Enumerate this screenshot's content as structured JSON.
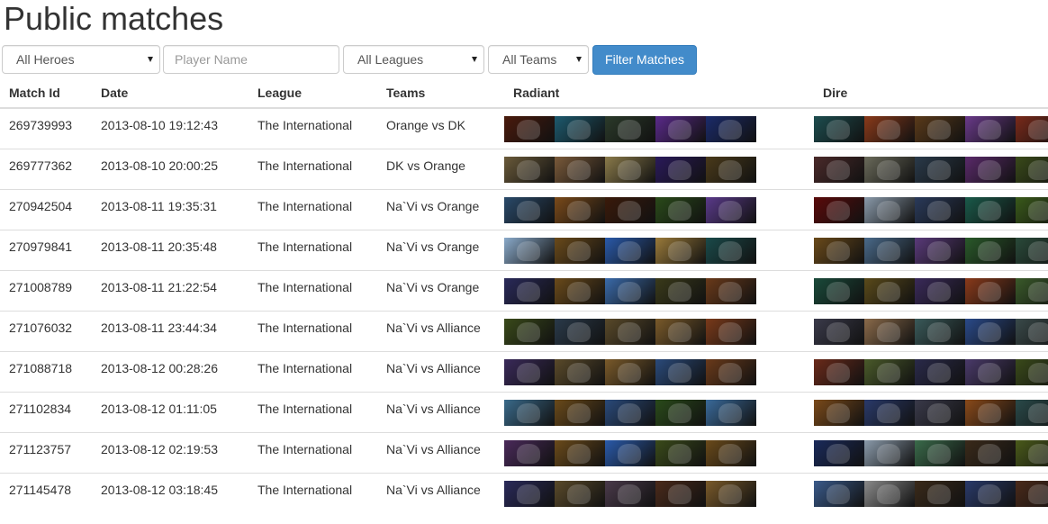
{
  "page": {
    "title": "Public matches"
  },
  "filters": {
    "heroes_selected": "All Heroes",
    "player_placeholder": "Player Name",
    "leagues_selected": "All Leagues",
    "teams_selected": "All Teams",
    "filter_button": "Filter Matches"
  },
  "table": {
    "headers": [
      "Match Id",
      "Date",
      "League",
      "Teams",
      "Radiant",
      "Dire"
    ],
    "rows": [
      {
        "match_id": "269739993",
        "date": "2013-08-10 19:12:43",
        "league": "The International",
        "teams": "Orange vs DK",
        "radiant": [
          "#4a1a0c",
          "#1d5a6e",
          "#2b3a2a",
          "#5a2a8a",
          "#1b2b6a"
        ],
        "dire": [
          "#1d4d4f",
          "#8a3a1a",
          "#5a3a1a",
          "#6a3a8a",
          "#7a2a1a"
        ]
      },
      {
        "match_id": "269777362",
        "date": "2013-08-10 20:00:25",
        "league": "The International",
        "teams": "DK vs Orange",
        "radiant": [
          "#6a5a3a",
          "#7a5a3a",
          "#8a7a4a",
          "#2a1a5a",
          "#4a3a1a"
        ],
        "dire": [
          "#4a2a2a",
          "#6a6a5a",
          "#2a3a4a",
          "#5a2a6a",
          "#3a4a1a"
        ]
      },
      {
        "match_id": "270942504",
        "date": "2013-08-11 19:35:31",
        "league": "The International",
        "teams": "Na`Vi vs Orange",
        "radiant": [
          "#2a4a6a",
          "#7a4a1a",
          "#3a1a0a",
          "#2a4a1a",
          "#5a3a8a"
        ],
        "dire": [
          "#5a0a0a",
          "#8a9aaa",
          "#2a3a5a",
          "#1a5a4a",
          "#3a5a1a"
        ]
      },
      {
        "match_id": "270979841",
        "date": "2013-08-11 20:35:48",
        "league": "The International",
        "teams": "Na`Vi vs Orange",
        "radiant": [
          "#8aaaca",
          "#6a4a1a",
          "#2a5aaa",
          "#9a7a3a",
          "#1a4a4a"
        ],
        "dire": [
          "#6a4a1a",
          "#4a6a8a",
          "#5a3a7a",
          "#2a5a2a",
          "#2a4a3a"
        ]
      },
      {
        "match_id": "271008789",
        "date": "2013-08-11 21:22:54",
        "league": "The International",
        "teams": "Na`Vi vs Orange",
        "radiant": [
          "#2a2a5a",
          "#6a4a1a",
          "#3a6aaa",
          "#3a3a1a",
          "#6a3a1a"
        ],
        "dire": [
          "#1a4a3a",
          "#5a4a1a",
          "#3a2a5a",
          "#8a3a1a",
          "#3a5a2a"
        ]
      },
      {
        "match_id": "271076032",
        "date": "2013-08-11 23:44:34",
        "league": "The International",
        "teams": "Na`Vi vs Alliance",
        "radiant": [
          "#3a4a1a",
          "#2a3a4a",
          "#5a4a2a",
          "#7a5a2a",
          "#7a3a1a"
        ],
        "dire": [
          "#3a3a4a",
          "#8a6a4a",
          "#3a5a5a",
          "#2a4a8a",
          "#3a4a4a"
        ]
      },
      {
        "match_id": "271088718",
        "date": "2013-08-12 00:28:26",
        "league": "The International",
        "teams": "Na`Vi vs Alliance",
        "radiant": [
          "#3a2a5a",
          "#5a4a2a",
          "#7a5a2a",
          "#2a4a7a",
          "#6a3a1a"
        ],
        "dire": [
          "#6a2a1a",
          "#4a5a2a",
          "#2a2a4a",
          "#4a3a6a",
          "#3a4a1a"
        ]
      },
      {
        "match_id": "271102834",
        "date": "2013-08-12 01:11:05",
        "league": "The International",
        "teams": "Na`Vi vs Alliance",
        "radiant": [
          "#3a6a8a",
          "#6a4a1a",
          "#2a4a7a",
          "#2a4a1a",
          "#3a6a9a"
        ],
        "dire": [
          "#7a4a1a",
          "#2a3a6a",
          "#3a3a4a",
          "#8a4a1a",
          "#2a4a4a"
        ]
      },
      {
        "match_id": "271123757",
        "date": "2013-08-12 02:19:53",
        "league": "The International",
        "teams": "Na`Vi vs Alliance",
        "radiant": [
          "#4a2a5a",
          "#6a4a1a",
          "#2a5aaa",
          "#3a4a1a",
          "#6a4a1a"
        ],
        "dire": [
          "#1a2a5a",
          "#8a9aaa",
          "#3a6a4a",
          "#3a2a1a",
          "#4a5a1a"
        ]
      },
      {
        "match_id": "271145478",
        "date": "2013-08-12 03:18:45",
        "league": "The International",
        "teams": "Na`Vi vs Alliance",
        "radiant": [
          "#2a2a5a",
          "#5a4a2a",
          "#4a3a4a",
          "#4a2a1a",
          "#7a5a2a"
        ],
        "dire": [
          "#3a5a8a",
          "#8a8a8a",
          "#3a2a1a",
          "#2a3a6a",
          "#4a2a1a"
        ]
      }
    ]
  },
  "colors": {
    "accent": "#428bca",
    "border": "#dddddd",
    "text": "#333333"
  }
}
